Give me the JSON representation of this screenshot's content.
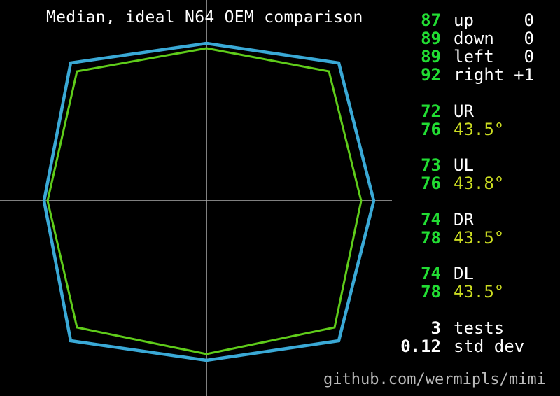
{
  "title": "Median, ideal N64 OEM comparison",
  "credit": "github.com/wermipls/mimi",
  "colors": {
    "ideal": "#3aa9d6",
    "median": "#5fcc1a",
    "axis": "#aaaaaa",
    "value": "#22dd33",
    "angle": "#ccdd22"
  },
  "cardinals": [
    {
      "value": "87",
      "label": "up",
      "offset": "0"
    },
    {
      "value": "89",
      "label": "down",
      "offset": "0"
    },
    {
      "value": "89",
      "label": "left",
      "offset": "0"
    },
    {
      "value": "92",
      "label": "right",
      "offset": "+1"
    }
  ],
  "diagonals": [
    {
      "label": "UR",
      "value": "72",
      "ideal_value": "76",
      "angle": "43.5°"
    },
    {
      "label": "UL",
      "value": "73",
      "ideal_value": "76",
      "angle": "43.8°"
    },
    {
      "label": "DR",
      "value": "74",
      "ideal_value": "78",
      "angle": "43.5°"
    },
    {
      "label": "DL",
      "value": "74",
      "ideal_value": "78",
      "angle": "43.5°"
    }
  ],
  "summary": [
    {
      "value": "3",
      "label": "tests"
    },
    {
      "value": "0.12",
      "label": "std dev"
    }
  ]
}
